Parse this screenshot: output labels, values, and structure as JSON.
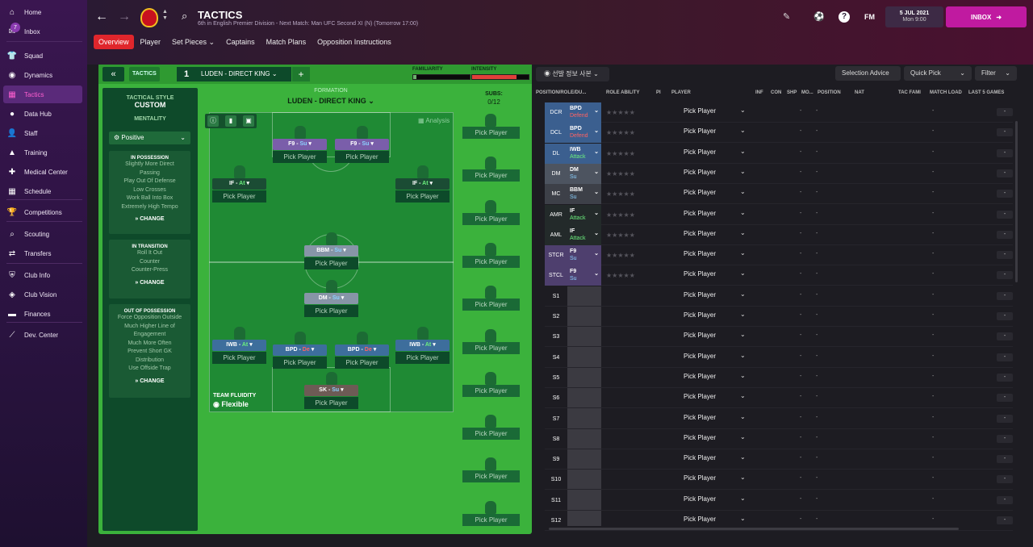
{
  "sidebar": {
    "items": [
      {
        "label": "Home",
        "icon": "home-icon",
        "glyph": "⌂"
      },
      {
        "label": "Inbox",
        "icon": "inbox-icon",
        "glyph": "✉",
        "badge": "7"
      },
      {
        "label": "Squad",
        "icon": "squad-icon",
        "glyph": "👕"
      },
      {
        "label": "Dynamics",
        "icon": "dynamics-icon",
        "glyph": "◉"
      },
      {
        "label": "Tactics",
        "icon": "tactics-icon",
        "glyph": "▦",
        "active": true
      },
      {
        "label": "Data Hub",
        "icon": "data-hub-icon",
        "glyph": "●"
      },
      {
        "label": "Staff",
        "icon": "staff-icon",
        "glyph": "👤"
      },
      {
        "label": "Training",
        "icon": "training-icon",
        "glyph": "▲"
      },
      {
        "label": "Medical Center",
        "icon": "medical-icon",
        "glyph": "✚"
      },
      {
        "label": "Schedule",
        "icon": "schedule-icon",
        "glyph": "▦"
      },
      {
        "label": "Competitions",
        "icon": "trophy-icon",
        "glyph": "🏆"
      },
      {
        "label": "Scouting",
        "icon": "scouting-icon",
        "glyph": "⌕"
      },
      {
        "label": "Transfers",
        "icon": "transfers-icon",
        "glyph": "⇄"
      },
      {
        "label": "Club Info",
        "icon": "club-info-icon",
        "glyph": "⛨"
      },
      {
        "label": "Club Vision",
        "icon": "club-vision-icon",
        "glyph": "◈"
      },
      {
        "label": "Finances",
        "icon": "finances-icon",
        "glyph": "▬"
      },
      {
        "label": "Dev. Center",
        "icon": "dev-center-icon",
        "glyph": "⟋"
      }
    ]
  },
  "header": {
    "title": "TACTICS",
    "subtitle": "6th in English Premier Division - Next Match: Man UFC Second XI (N) (Tomorrow 17:00)",
    "date": "5 JUL 2021",
    "time": "Mon 9:00",
    "inbox": "INBOX",
    "fm": "FM",
    "help": "?"
  },
  "subtabs": [
    "Overview",
    "Player",
    "Set Pieces ⌄",
    "Captains",
    "Match Plans",
    "Opposition Instructions"
  ],
  "tactic": {
    "label": "TACTICS",
    "slot": "1",
    "name": "LUDEN - DIRECT KING",
    "familiarity_label": "FAMILIARITY",
    "intensity_label": "INTENSITY",
    "familiarity": 0.05,
    "intensity": 0.78,
    "formation_label": "FORMATION",
    "formation": "LUDEN - DIRECT KING",
    "subs_label": "SUBS:",
    "subs": "0/12",
    "analysis": "Analysis",
    "fluidity_label": "TEAM FLUIDITY",
    "fluidity": "Flexible",
    "style_label": "TACTICAL STYLE",
    "style": "CUSTOM",
    "mentality_label": "MENTALITY",
    "mentality": "Positive",
    "possession": {
      "title": "IN POSSESSION",
      "items": [
        "Slightly More Direct",
        "Passing",
        "Play Out Of Defense",
        "Low Crosses",
        "Work Ball Into Box",
        "Extremely High Tempo"
      ],
      "change": "CHANGE"
    },
    "transition": {
      "title": "IN TRANSITION",
      "items": [
        "Roll It Out",
        "Counter",
        "Counter-Press"
      ],
      "change": "CHANGE"
    },
    "out": {
      "title": "OUT OF POSSESSION",
      "items": [
        "Force Opposition Outside",
        "Much Higher Line of",
        "Engagement",
        "Much More Often",
        "Prevent Short GK",
        "Distribution",
        "Use Offside Trap"
      ],
      "change": "CHANGE"
    }
  },
  "pitch_players": [
    {
      "role": "F9",
      "duty": "Su",
      "pick": "Pick Player",
      "cls": "stk"
    },
    {
      "role": "F9",
      "duty": "Su",
      "pick": "Pick Player",
      "cls": "stk"
    },
    {
      "role": "IF",
      "duty": "At",
      "pick": "Pick Player",
      "cls": "att"
    },
    {
      "role": "IF",
      "duty": "At",
      "pick": "Pick Player",
      "cls": "att"
    },
    {
      "role": "BBM",
      "duty": "Su",
      "pick": "Pick Player",
      "cls": "mid"
    },
    {
      "role": "DM",
      "duty": "Su",
      "pick": "Pick Player",
      "cls": "mid"
    },
    {
      "role": "IWB",
      "duty": "At",
      "pick": "Pick Player",
      "cls": "def"
    },
    {
      "role": "BPD",
      "duty": "De",
      "pick": "Pick Player",
      "cls": "def"
    },
    {
      "role": "BPD",
      "duty": "De",
      "pick": "Pick Player",
      "cls": "def"
    },
    {
      "role": "IWB",
      "duty": "At",
      "pick": "Pick Player",
      "cls": "def"
    },
    {
      "role": "SK",
      "duty": "Su",
      "pick": "Pick Player",
      "cls": "gk"
    }
  ],
  "subs_pick": "Pick Player",
  "list": {
    "view": "선발 정보 사본",
    "selection_advice": "Selection Advice",
    "quick_pick": "Quick Pick",
    "filter": "Filter",
    "columns": [
      "POSITION/ROLE/DU...",
      "ROLE ABILITY",
      "PI",
      "PLAYER",
      "INF",
      "CON",
      "SHP",
      "MO...",
      "POSITION",
      "NAT",
      "TAC FAMI",
      "MATCH LOAD",
      "LAST 5 GAMES"
    ],
    "rows": [
      {
        "pos": "DCR",
        "role": "BPD",
        "duty": "Defend",
        "color": "#3b5f8f",
        "dutycolor": "#ff6363"
      },
      {
        "pos": "DCL",
        "role": "BPD",
        "duty": "Defend",
        "color": "#3b5f8f",
        "dutycolor": "#ff6363"
      },
      {
        "pos": "DL",
        "role": "IWB",
        "duty": "Attack",
        "color": "#3b5f8f",
        "dutycolor": "#6cf07e"
      },
      {
        "pos": "DM",
        "role": "DM",
        "duty": "Su",
        "color": "#4d5460",
        "dutycolor": "#8cd1ff"
      },
      {
        "pos": "MC",
        "role": "BBM",
        "duty": "Su",
        "color": "#3d4048",
        "dutycolor": "#8cd1ff"
      },
      {
        "pos": "AMR",
        "role": "IF",
        "duty": "Attack",
        "color": "#232a2a",
        "dutycolor": "#6cf07e"
      },
      {
        "pos": "AML",
        "role": "IF",
        "duty": "Attack",
        "color": "#232a2a",
        "dutycolor": "#6cf07e"
      },
      {
        "pos": "STCR",
        "role": "F9",
        "duty": "Su",
        "color": "#4e3f6e",
        "dutycolor": "#8cd1ff"
      },
      {
        "pos": "STCL",
        "role": "F9",
        "duty": "Su",
        "color": "#4e3f6e",
        "dutycolor": "#8cd1ff"
      },
      {
        "pos": "S1"
      },
      {
        "pos": "S2"
      },
      {
        "pos": "S3"
      },
      {
        "pos": "S4"
      },
      {
        "pos": "S5"
      },
      {
        "pos": "S6"
      },
      {
        "pos": "S7"
      },
      {
        "pos": "S8"
      },
      {
        "pos": "S9"
      },
      {
        "pos": "S10"
      },
      {
        "pos": "S11"
      },
      {
        "pos": "S12"
      }
    ],
    "pick": "Pick Player",
    "dash": "-",
    "stars": "★★★★★",
    "minus": "-"
  }
}
